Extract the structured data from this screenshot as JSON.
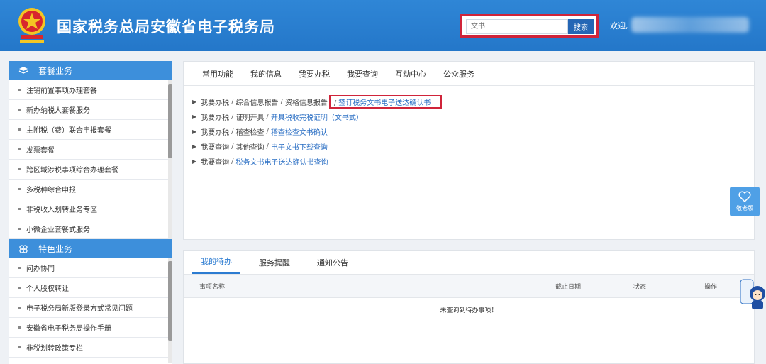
{
  "header": {
    "title": "国家税务总局安徽省电子税务局",
    "search_placeholder": "文书",
    "search_button": "搜索",
    "welcome": "欢迎,",
    "logo_icon": "tax-emblem-icon",
    "brand_color": "#2477c9",
    "highlight_color": "#d0243a"
  },
  "sidebar": {
    "sections": [
      {
        "title": "套餐业务",
        "icon": "layers-icon",
        "items": [
          "注销前置事项办理套餐",
          "新办纳税人套餐服务",
          "主附税（费）联合申报套餐",
          "发票套餐",
          "跨区域涉税事项综合办理套餐",
          "多税种综合申报",
          "非税收入划转业务专区",
          "小微企业套餐式服务"
        ]
      },
      {
        "title": "特色业务",
        "icon": "flower-icon",
        "items": [
          "问办协同",
          "个人股权转让",
          "电子税务局新版登录方式常见问题",
          "安徽省电子税务局操作手册",
          "非税划转政策专栏"
        ]
      }
    ]
  },
  "main": {
    "tabs": [
      "常用功能",
      "我的信息",
      "我要办税",
      "我要查询",
      "互动中心",
      "公众服务"
    ],
    "paths": [
      {
        "segments": [
          "我要办税",
          "综合信息报告",
          "资格信息报告"
        ],
        "last": "签订税务文书电子送达确认书",
        "highlighted": true
      },
      {
        "segments": [
          "我要办税",
          "证明开具"
        ],
        "last": "开具税收完税证明（文书式）",
        "highlighted": false
      },
      {
        "segments": [
          "我要办税",
          "稽查检查"
        ],
        "last": "稽查检查文书确认",
        "highlighted": false
      },
      {
        "segments": [
          "我要查询",
          "其他查询"
        ],
        "last": "电子文书下载查询",
        "highlighted": false
      },
      {
        "segments": [
          "我要查询"
        ],
        "last": "税务文书电子送达确认书查询",
        "highlighted": false
      }
    ],
    "elder_label": "敬老版",
    "elder_icon": "elder-mode-icon"
  },
  "todo": {
    "tabs": [
      "我的待办",
      "服务提醒",
      "通知公告"
    ],
    "active_tab": "我的待办",
    "columns": {
      "name": "事项名称",
      "deadline": "截止日期",
      "status": "状态",
      "action": "操作"
    },
    "empty_text": "未查询到待办事项！"
  }
}
